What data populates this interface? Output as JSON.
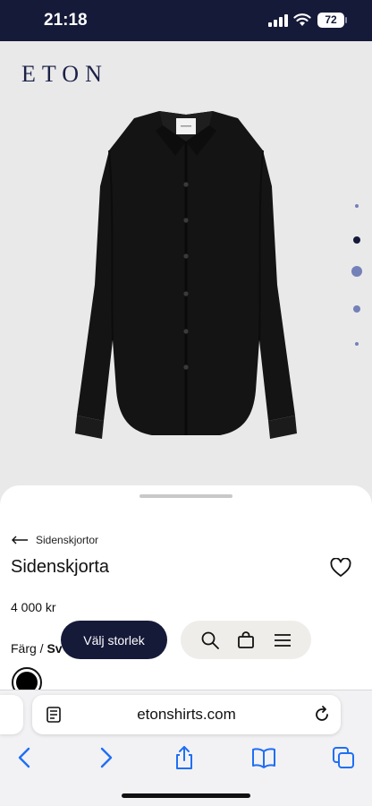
{
  "status_bar": {
    "time": "21:18",
    "battery": "72"
  },
  "brand": {
    "logo": "ETON"
  },
  "product": {
    "back_label": "Sidenskjortor",
    "title": "Sidenskjorta",
    "price": "4 000 kr",
    "color_label": "Färg / ",
    "color_value": "Sv",
    "size_button": "Välj storlek"
  },
  "gallery": {
    "image_count": 5,
    "active_index": 1
  },
  "browser": {
    "url": "etonshirts.com"
  },
  "colors": {
    "navy": "#161a39",
    "accent_dot": "#7480b8",
    "pill": "#efedea",
    "safari_blue": "#1f6ff5"
  },
  "icons": [
    "heart-icon",
    "search-icon",
    "bag-icon",
    "menu-icon",
    "reader-icon",
    "reload-icon",
    "back-icon",
    "forward-icon",
    "share-icon",
    "bookmarks-icon",
    "tabs-icon"
  ]
}
